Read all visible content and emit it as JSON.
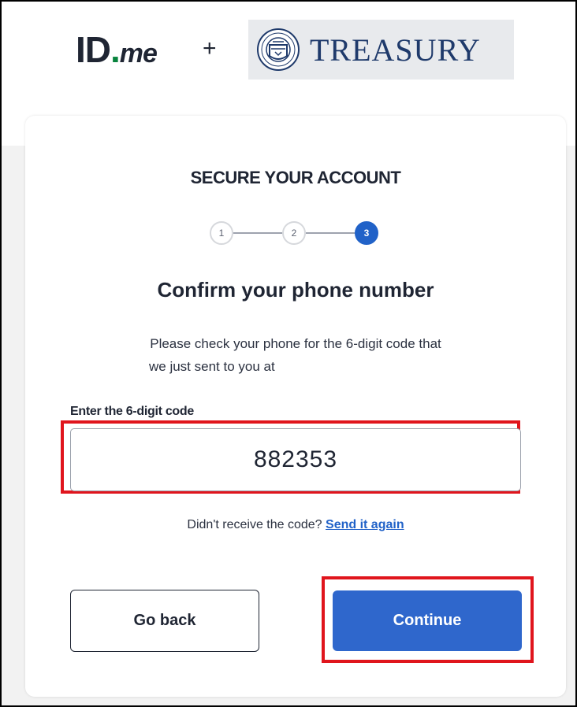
{
  "header": {
    "idme_logo": {
      "id": "ID",
      "dot": ".",
      "me": "me"
    },
    "plus": "+",
    "partner_logo_text": "TREASURY"
  },
  "card": {
    "eyebrow": "SECURE YOUR ACCOUNT",
    "stepper": {
      "steps": [
        {
          "label": "1",
          "state": "complete"
        },
        {
          "label": "2",
          "state": "complete"
        },
        {
          "label": "3",
          "state": "active"
        }
      ]
    },
    "heading": "Confirm your phone number",
    "description_line1": "Please check your phone for the 6-digit code that",
    "description_line2": "we just sent to you at",
    "code_field": {
      "label": "Enter the 6-digit code",
      "value": "882353"
    },
    "resend": {
      "prompt": "Didn't receive the code?",
      "link": "Send it again"
    },
    "buttons": {
      "back": "Go back",
      "continue": "Continue"
    }
  },
  "colors": {
    "primary": "#2f67cc",
    "highlight": "#e0151d",
    "text": "#1f2533",
    "idme_green": "#08833d",
    "treasury_blue": "#1f3a6b"
  },
  "icons": [
    "idme-logo",
    "treasury-seal-icon"
  ]
}
